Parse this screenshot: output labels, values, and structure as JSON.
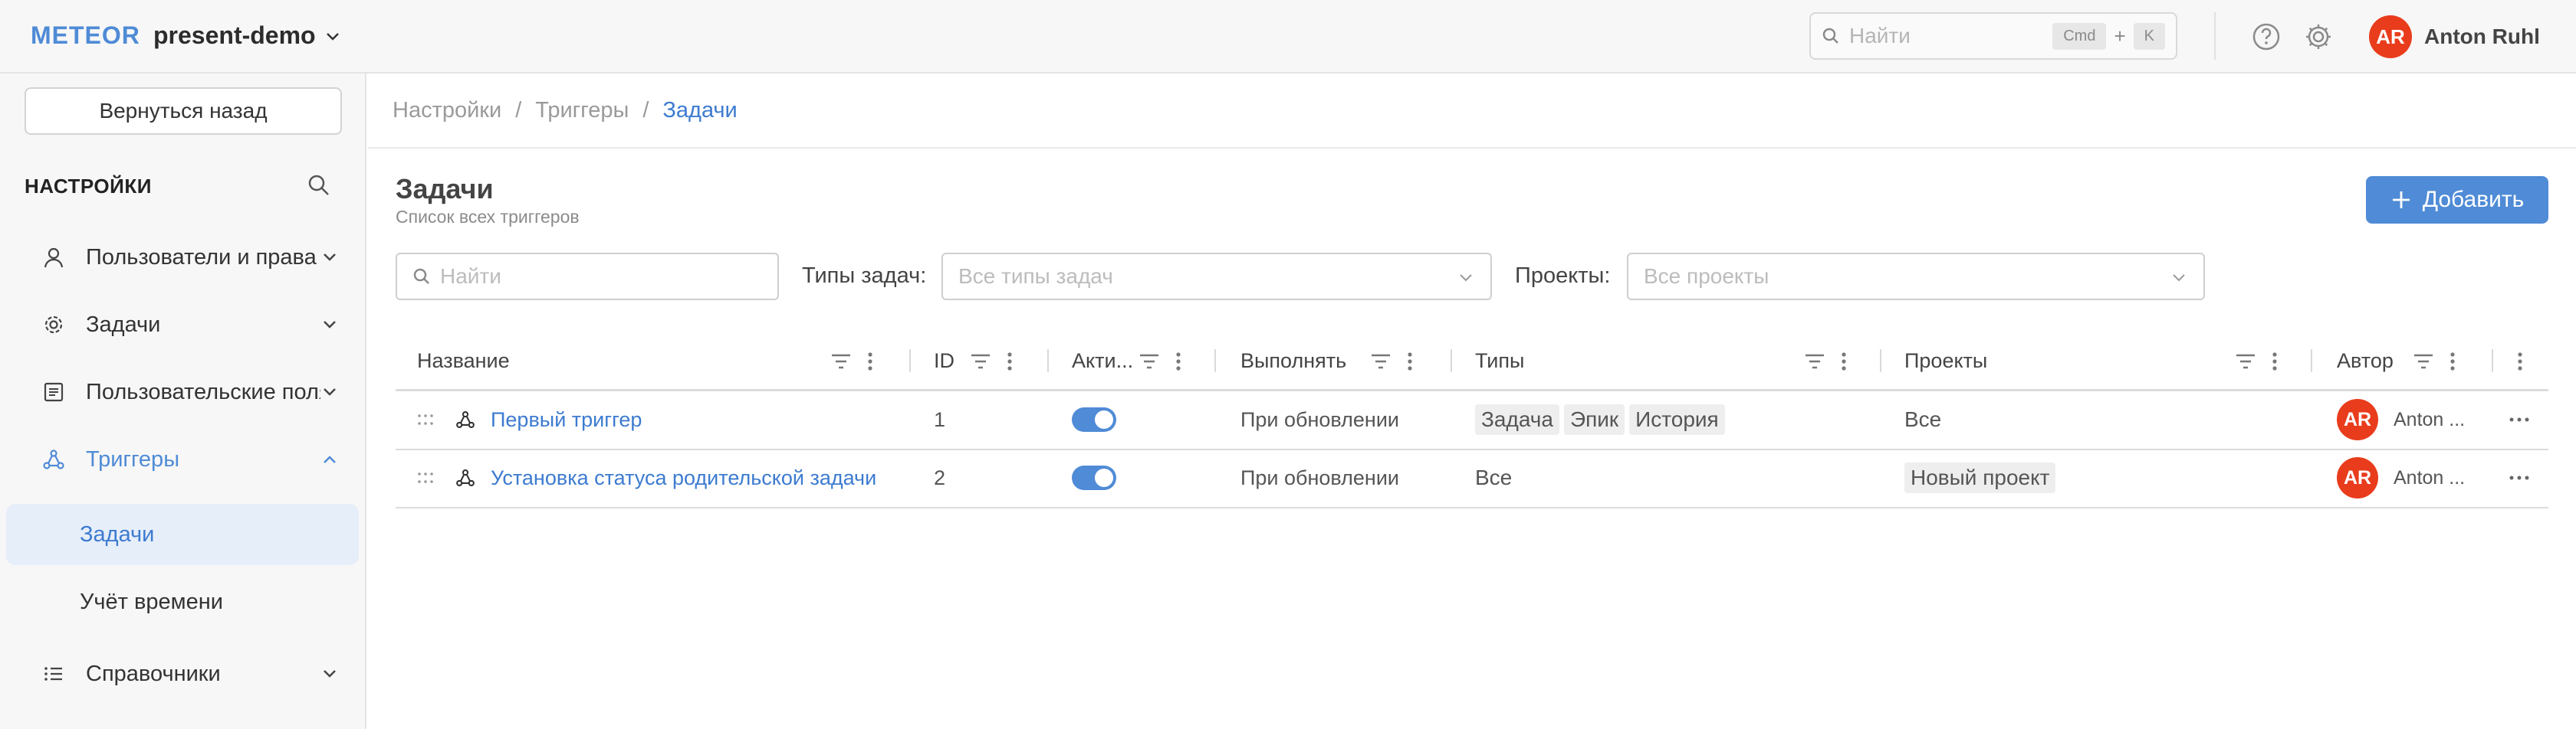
{
  "header": {
    "logo": "METEOR",
    "project": "present-demo",
    "search_placeholder": "Найти",
    "kbd_cmd": "Cmd",
    "kbd_plus": "+",
    "kbd_k": "K",
    "user_initials": "AR",
    "user_name": "Anton Ruhl"
  },
  "sidebar": {
    "back_label": "Вернуться назад",
    "title": "НАСТРОЙКИ",
    "items": [
      {
        "label": "Пользователи и права",
        "icon": "user-icon"
      },
      {
        "label": "Задачи",
        "icon": "gear-icon"
      },
      {
        "label": "Пользовательские поля",
        "icon": "form-icon"
      },
      {
        "label": "Триггеры",
        "icon": "trigger-icon"
      },
      {
        "label": "Справочники",
        "icon": "list-icon"
      }
    ],
    "subitems": [
      {
        "label": "Задачи"
      },
      {
        "label": "Учёт времени"
      }
    ]
  },
  "breadcrumbs": [
    "Настройки",
    "/",
    "Триггеры",
    "/",
    "Задачи"
  ],
  "page": {
    "title": "Задачи",
    "subtitle": "Список всех триггеров",
    "add_label": "Добавить"
  },
  "filters": {
    "search_placeholder": "Найти",
    "types_label": "Типы задач",
    "types_placeholder": "Все типы задач",
    "projects_label": "Проекты",
    "projects_placeholder": "Все проекты"
  },
  "table": {
    "columns": [
      "Название",
      "ID",
      "Акти...",
      "Выполнять",
      "Типы",
      "Проекты",
      "Автор"
    ],
    "rows": [
      {
        "name": "Первый триггер",
        "id": "1",
        "active": true,
        "execute": "При обновлении",
        "types": [
          "Задача",
          "Эпик",
          "История"
        ],
        "projects_text": "Все",
        "author_initials": "AR",
        "author": "Anton ..."
      },
      {
        "name": "Установка статуса родительской задачи",
        "id": "2",
        "active": true,
        "execute": "При обновлении",
        "types_text": "Все",
        "projects": [
          "Новый проект"
        ],
        "author_initials": "AR",
        "author": "Anton ..."
      }
    ]
  }
}
